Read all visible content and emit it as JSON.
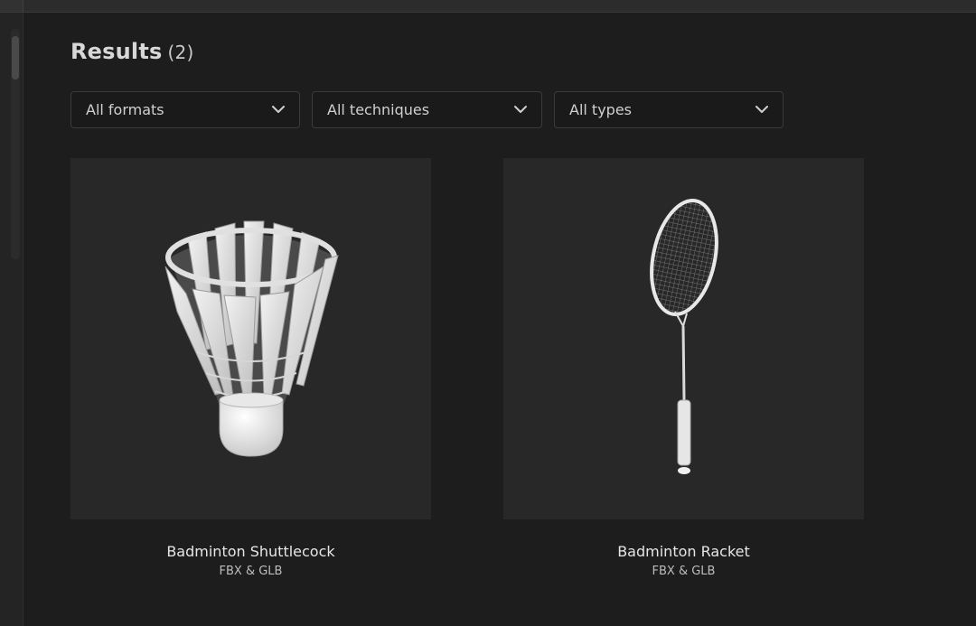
{
  "header": {
    "title": "Results",
    "count": "(2)"
  },
  "filters": [
    {
      "label": "All formats",
      "icon": "chevron-down-icon"
    },
    {
      "label": "All techniques",
      "icon": "chevron-down-icon"
    },
    {
      "label": "All types",
      "icon": "chevron-down-icon"
    }
  ],
  "results": [
    {
      "title": "Badminton Shuttlecock",
      "formats": "FBX & GLB",
      "thumbnail": "shuttlecock-icon"
    },
    {
      "title": "Badminton Racket",
      "formats": "FBX & GLB",
      "thumbnail": "racket-icon"
    }
  ],
  "colors": {
    "background": "#1d1d1d",
    "card": "#282828",
    "text": "#e6e6e6"
  }
}
